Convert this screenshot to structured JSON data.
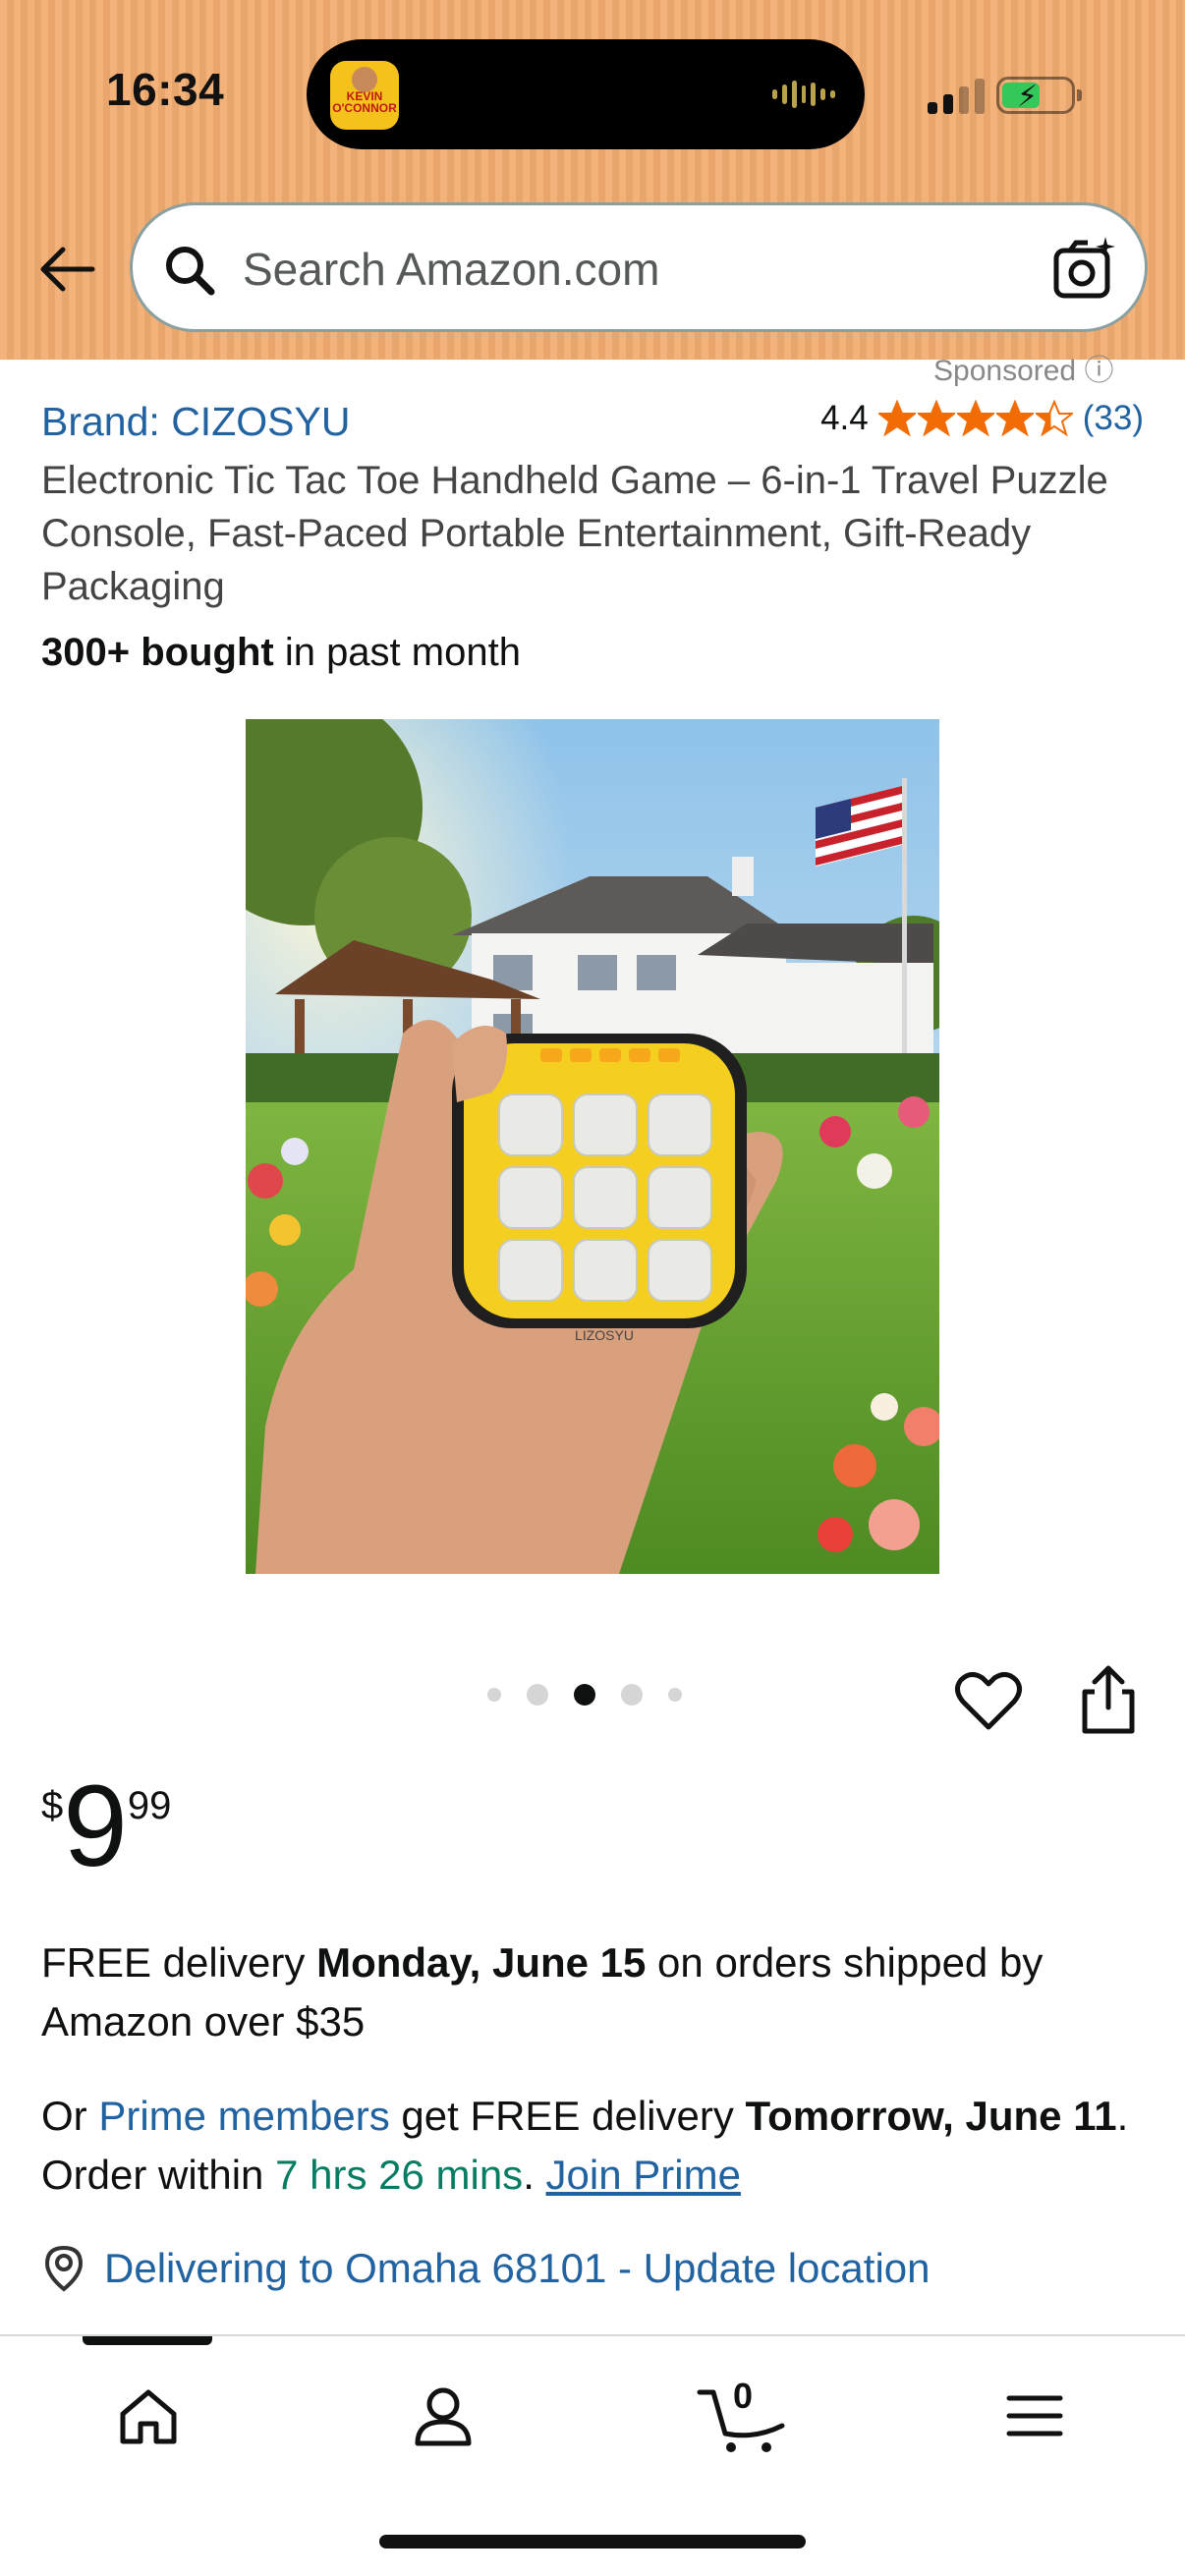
{
  "status_bar": {
    "time": "16:34",
    "island_app_text": "KEVIN O'CONNOR"
  },
  "search": {
    "placeholder": "Search Amazon.com"
  },
  "product": {
    "brand": "Brand: CIZOSYU",
    "rating": "4.4",
    "stars": 4.4,
    "review_count": "(33)",
    "title": "Electronic Tic Tac Toe Handheld Game – 6-in-1 Travel Puzzle Console, Fast-Paced Portable Entertainment, Gift-Ready Packaging",
    "bought_bold": "300+ bought",
    "bought_rest": " in past month",
    "device_label": "LIZOSYU"
  },
  "carousel": {
    "total_dots": 5,
    "active_index": 2
  },
  "price": {
    "symbol": "$",
    "whole": "9",
    "fraction": "99"
  },
  "delivery": {
    "prefix": "FREE delivery ",
    "date": "Monday, June 15",
    "suffix": " on orders shipped by Amazon over $35"
  },
  "prime": {
    "prefix": "Or ",
    "members_link": "Prime members",
    "middle": " get FREE delivery ",
    "date": "Tomorrow, June 11",
    "order_within": ". Order within ",
    "countdown": "7 hrs 26 mins",
    "period": ". ",
    "join_link": "Join Prime"
  },
  "location": {
    "text": "Delivering to Omaha 68101 - Update location"
  },
  "bottom_nav": {
    "cart_count": "0",
    "items": [
      "home-icon",
      "account-icon",
      "cart-icon",
      "menu-icon"
    ]
  },
  "colors": {
    "header_bg": "#f2b27a",
    "link": "#2162a1",
    "star": "#f26c06",
    "countdown": "#067d62",
    "device_yellow": "#f5cf1f"
  }
}
